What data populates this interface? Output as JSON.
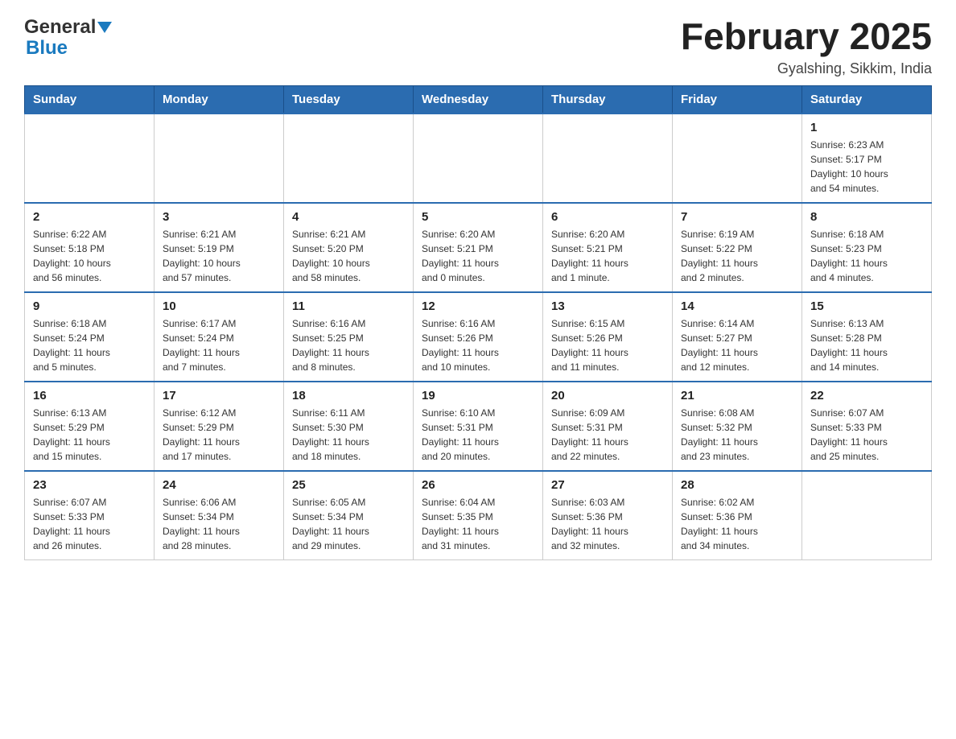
{
  "header": {
    "logo_general": "General",
    "logo_blue": "Blue",
    "month_title": "February 2025",
    "location": "Gyalshing, Sikkim, India"
  },
  "days_of_week": [
    "Sunday",
    "Monday",
    "Tuesday",
    "Wednesday",
    "Thursday",
    "Friday",
    "Saturday"
  ],
  "weeks": [
    [
      {
        "day": "",
        "info": ""
      },
      {
        "day": "",
        "info": ""
      },
      {
        "day": "",
        "info": ""
      },
      {
        "day": "",
        "info": ""
      },
      {
        "day": "",
        "info": ""
      },
      {
        "day": "",
        "info": ""
      },
      {
        "day": "1",
        "info": "Sunrise: 6:23 AM\nSunset: 5:17 PM\nDaylight: 10 hours\nand 54 minutes."
      }
    ],
    [
      {
        "day": "2",
        "info": "Sunrise: 6:22 AM\nSunset: 5:18 PM\nDaylight: 10 hours\nand 56 minutes."
      },
      {
        "day": "3",
        "info": "Sunrise: 6:21 AM\nSunset: 5:19 PM\nDaylight: 10 hours\nand 57 minutes."
      },
      {
        "day": "4",
        "info": "Sunrise: 6:21 AM\nSunset: 5:20 PM\nDaylight: 10 hours\nand 58 minutes."
      },
      {
        "day": "5",
        "info": "Sunrise: 6:20 AM\nSunset: 5:21 PM\nDaylight: 11 hours\nand 0 minutes."
      },
      {
        "day": "6",
        "info": "Sunrise: 6:20 AM\nSunset: 5:21 PM\nDaylight: 11 hours\nand 1 minute."
      },
      {
        "day": "7",
        "info": "Sunrise: 6:19 AM\nSunset: 5:22 PM\nDaylight: 11 hours\nand 2 minutes."
      },
      {
        "day": "8",
        "info": "Sunrise: 6:18 AM\nSunset: 5:23 PM\nDaylight: 11 hours\nand 4 minutes."
      }
    ],
    [
      {
        "day": "9",
        "info": "Sunrise: 6:18 AM\nSunset: 5:24 PM\nDaylight: 11 hours\nand 5 minutes."
      },
      {
        "day": "10",
        "info": "Sunrise: 6:17 AM\nSunset: 5:24 PM\nDaylight: 11 hours\nand 7 minutes."
      },
      {
        "day": "11",
        "info": "Sunrise: 6:16 AM\nSunset: 5:25 PM\nDaylight: 11 hours\nand 8 minutes."
      },
      {
        "day": "12",
        "info": "Sunrise: 6:16 AM\nSunset: 5:26 PM\nDaylight: 11 hours\nand 10 minutes."
      },
      {
        "day": "13",
        "info": "Sunrise: 6:15 AM\nSunset: 5:26 PM\nDaylight: 11 hours\nand 11 minutes."
      },
      {
        "day": "14",
        "info": "Sunrise: 6:14 AM\nSunset: 5:27 PM\nDaylight: 11 hours\nand 12 minutes."
      },
      {
        "day": "15",
        "info": "Sunrise: 6:13 AM\nSunset: 5:28 PM\nDaylight: 11 hours\nand 14 minutes."
      }
    ],
    [
      {
        "day": "16",
        "info": "Sunrise: 6:13 AM\nSunset: 5:29 PM\nDaylight: 11 hours\nand 15 minutes."
      },
      {
        "day": "17",
        "info": "Sunrise: 6:12 AM\nSunset: 5:29 PM\nDaylight: 11 hours\nand 17 minutes."
      },
      {
        "day": "18",
        "info": "Sunrise: 6:11 AM\nSunset: 5:30 PM\nDaylight: 11 hours\nand 18 minutes."
      },
      {
        "day": "19",
        "info": "Sunrise: 6:10 AM\nSunset: 5:31 PM\nDaylight: 11 hours\nand 20 minutes."
      },
      {
        "day": "20",
        "info": "Sunrise: 6:09 AM\nSunset: 5:31 PM\nDaylight: 11 hours\nand 22 minutes."
      },
      {
        "day": "21",
        "info": "Sunrise: 6:08 AM\nSunset: 5:32 PM\nDaylight: 11 hours\nand 23 minutes."
      },
      {
        "day": "22",
        "info": "Sunrise: 6:07 AM\nSunset: 5:33 PM\nDaylight: 11 hours\nand 25 minutes."
      }
    ],
    [
      {
        "day": "23",
        "info": "Sunrise: 6:07 AM\nSunset: 5:33 PM\nDaylight: 11 hours\nand 26 minutes."
      },
      {
        "day": "24",
        "info": "Sunrise: 6:06 AM\nSunset: 5:34 PM\nDaylight: 11 hours\nand 28 minutes."
      },
      {
        "day": "25",
        "info": "Sunrise: 6:05 AM\nSunset: 5:34 PM\nDaylight: 11 hours\nand 29 minutes."
      },
      {
        "day": "26",
        "info": "Sunrise: 6:04 AM\nSunset: 5:35 PM\nDaylight: 11 hours\nand 31 minutes."
      },
      {
        "day": "27",
        "info": "Sunrise: 6:03 AM\nSunset: 5:36 PM\nDaylight: 11 hours\nand 32 minutes."
      },
      {
        "day": "28",
        "info": "Sunrise: 6:02 AM\nSunset: 5:36 PM\nDaylight: 11 hours\nand 34 minutes."
      },
      {
        "day": "",
        "info": ""
      }
    ]
  ]
}
